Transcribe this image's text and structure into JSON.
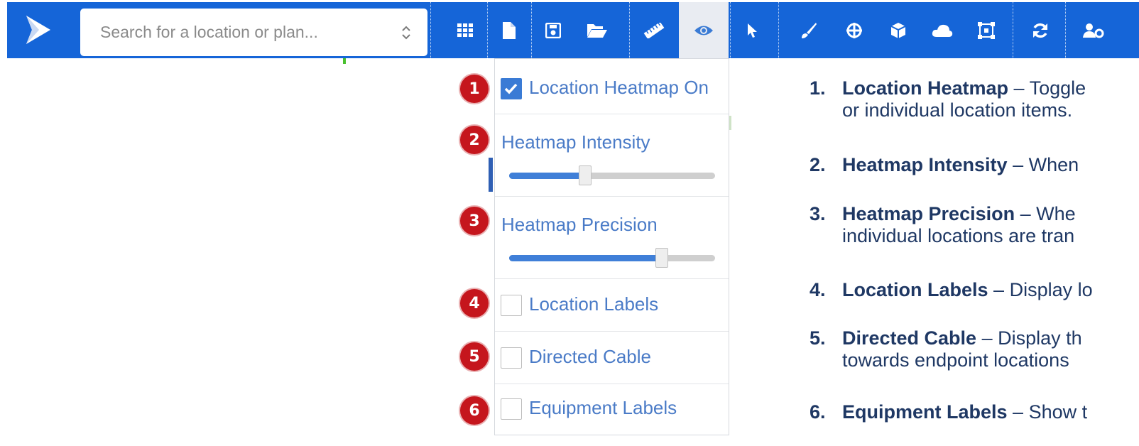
{
  "toolbar": {
    "search_placeholder": "Search for a location or plan...",
    "colors": {
      "bar": "#1565d8",
      "active_bg": "#e9ecf2",
      "accent": "#3a7bd5",
      "badge": "#c5161d"
    },
    "buttons": [
      {
        "name": "grid-icon"
      },
      {
        "name": "document-icon"
      },
      {
        "name": "save-icon"
      },
      {
        "name": "folder-open-icon"
      },
      {
        "name": "ruler-icon"
      },
      {
        "name": "eye-icon"
      },
      {
        "name": "pointer-icon"
      },
      {
        "name": "brush-icon"
      },
      {
        "name": "crosshair-icon"
      },
      {
        "name": "cube-icon"
      },
      {
        "name": "cloud-icon"
      },
      {
        "name": "bounding-box-icon"
      },
      {
        "name": "refresh-icon"
      },
      {
        "name": "users-gear-icon"
      }
    ]
  },
  "dropdown": {
    "heatmap_on": {
      "badge": "1",
      "label": "Location Heatmap On",
      "checked": true
    },
    "intensity": {
      "badge": "2",
      "label": "Heatmap Intensity",
      "value_fraction": 0.37
    },
    "precision": {
      "badge": "3",
      "label": "Heatmap Precision",
      "value_fraction": 0.74
    },
    "location_labels": {
      "badge": "4",
      "label": "Location Labels",
      "checked": false
    },
    "directed_cable": {
      "badge": "5",
      "label": "Directed Cable",
      "checked": false
    },
    "equipment_labels": {
      "badge": "6",
      "label": "Equipment Labels",
      "checked": false
    }
  },
  "notes": [
    {
      "num": "1.",
      "title": "Location Heatmap",
      "text": " – Toggle",
      "line2": "or individual location items."
    },
    {
      "num": "2.",
      "title": "Heatmap Intensity",
      "text": " – When"
    },
    {
      "num": "3.",
      "title": "Heatmap Precision",
      "text": "  – Whe",
      "line2": "individual locations are tran"
    },
    {
      "num": "4.",
      "title": "Location Labels",
      "text": " – Display lo"
    },
    {
      "num": "5.",
      "title": "Directed Cable",
      "text": " – Display th",
      "line2": "towards endpoint locations"
    },
    {
      "num": "6.",
      "title": "Equipment Labels",
      "text": " – Show t"
    }
  ]
}
